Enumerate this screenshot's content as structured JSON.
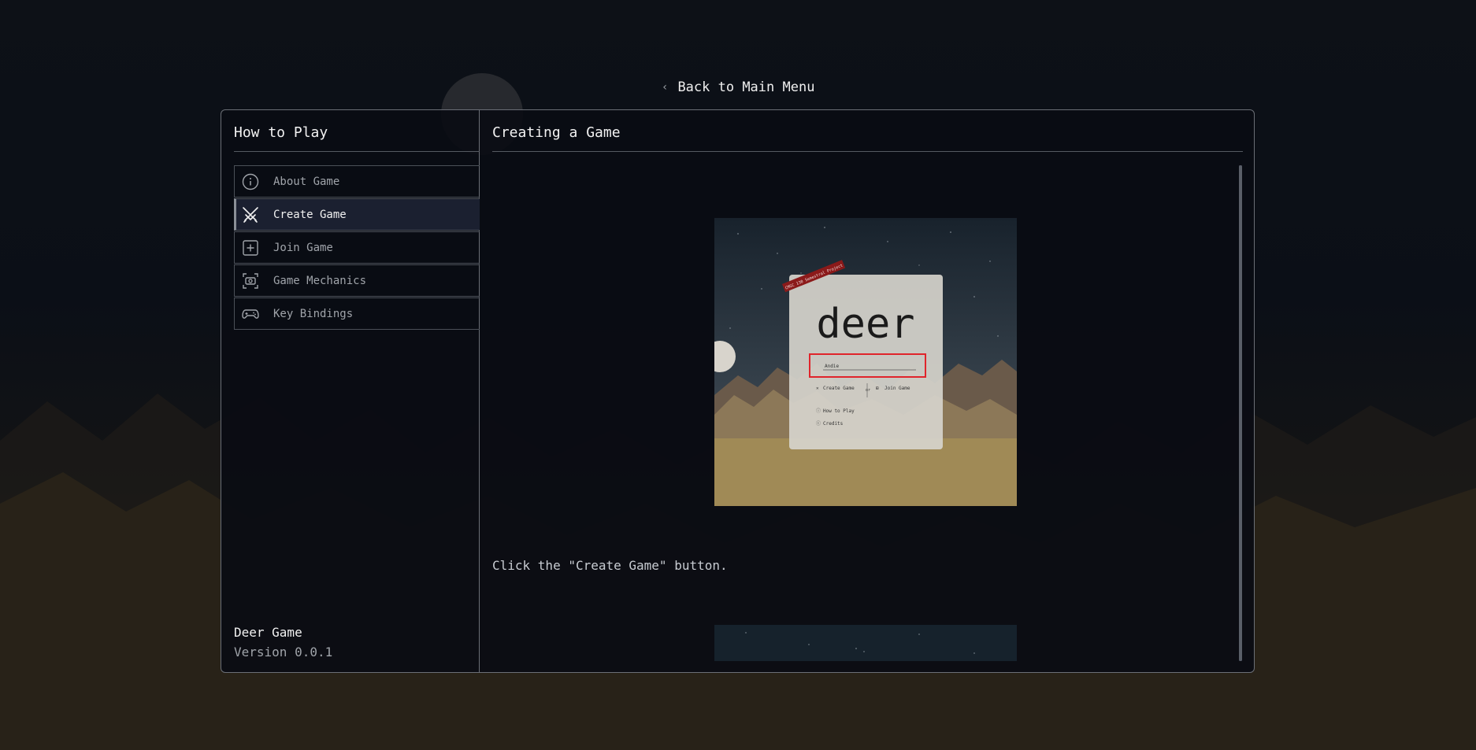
{
  "back_link": {
    "label": "Back to Main Menu"
  },
  "sidebar": {
    "title": "How to Play",
    "items": [
      {
        "label": "About Game",
        "icon": "info-icon",
        "active": false
      },
      {
        "label": "Create Game",
        "icon": "swords-icon",
        "active": true
      },
      {
        "label": "Join Game",
        "icon": "plus-square-icon",
        "active": false
      },
      {
        "label": "Game Mechanics",
        "icon": "mechanics-icon",
        "active": false
      },
      {
        "label": "Key Bindings",
        "icon": "gamepad-icon",
        "active": false
      }
    ],
    "footer": {
      "name": "Deer Game",
      "version": "Version 0.0.1"
    }
  },
  "main": {
    "title": "Creating a Game",
    "caption": "Click the \"Create Game\" button.",
    "screenshot": {
      "ribbon": "CMSC 130 Semestral Project",
      "logo": "deer",
      "name_value": "Andie",
      "create_label": "Create Game",
      "or_label": "or",
      "join_label": "Join Game",
      "howto_label": "How to Play",
      "credits_label": "Credits"
    }
  },
  "colors": {
    "accent_border": "#6b6f76",
    "highlight_red": "#e0242b",
    "sand": "#a08a56",
    "ribbon": "#8b1a1a"
  }
}
